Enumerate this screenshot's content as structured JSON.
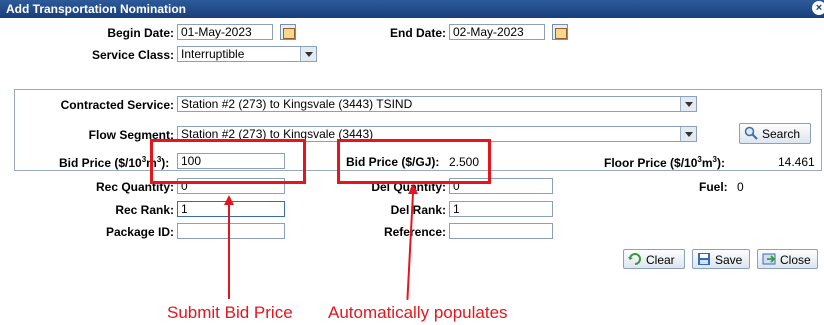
{
  "window": {
    "title": "Add Transportation Nomination",
    "close_glyph": "×"
  },
  "form": {
    "begin_date": {
      "label": "Begin Date:",
      "value": "01-May-2023"
    },
    "end_date": {
      "label": "End Date:",
      "value": "02-May-2023"
    },
    "service_class": {
      "label": "Service Class:",
      "value": "Interruptible"
    },
    "contracted_service": {
      "label": "Contracted Service:",
      "value": "Station #2 (273) to Kingsvale (3443) TSIND"
    },
    "flow_segment": {
      "label": "Flow Segment:",
      "value": "Station #2 (273) to Kingsvale (3443)"
    },
    "bid_price_m3": {
      "label_pre": "Bid Price ($/10",
      "label_sup1": "3",
      "label_mid": "m",
      "label_sup2": "3",
      "label_post": "):",
      "value": "100"
    },
    "bid_price_gj": {
      "label": "Bid Price ($/GJ):",
      "value": "2.500"
    },
    "floor_price": {
      "label_pre": "Floor Price ($/10",
      "label_sup1": "3",
      "label_mid": "m",
      "label_sup2": "3",
      "label_post": "):",
      "value": "14.461"
    },
    "rec_quantity": {
      "label": "Rec Quantity:",
      "value": "0"
    },
    "del_quantity": {
      "label": "Del Quantity:",
      "value": "0"
    },
    "fuel": {
      "label": "Fuel:",
      "value": "0"
    },
    "rec_rank": {
      "label": "Rec Rank:",
      "value": "1"
    },
    "del_rank": {
      "label": "Del Rank:",
      "value": "1"
    },
    "package_id": {
      "label": "Package ID:",
      "value": ""
    },
    "reference": {
      "label": "Reference:",
      "value": ""
    }
  },
  "buttons": {
    "search": "Search",
    "clear": "Clear",
    "save": "Save",
    "close": "Close"
  },
  "annotations": {
    "submit": "Submit Bid Price",
    "auto": "Automatically populates"
  },
  "colors": {
    "annotation_red": "#e8141b",
    "titlebar_blue": "#1a3f7a"
  }
}
